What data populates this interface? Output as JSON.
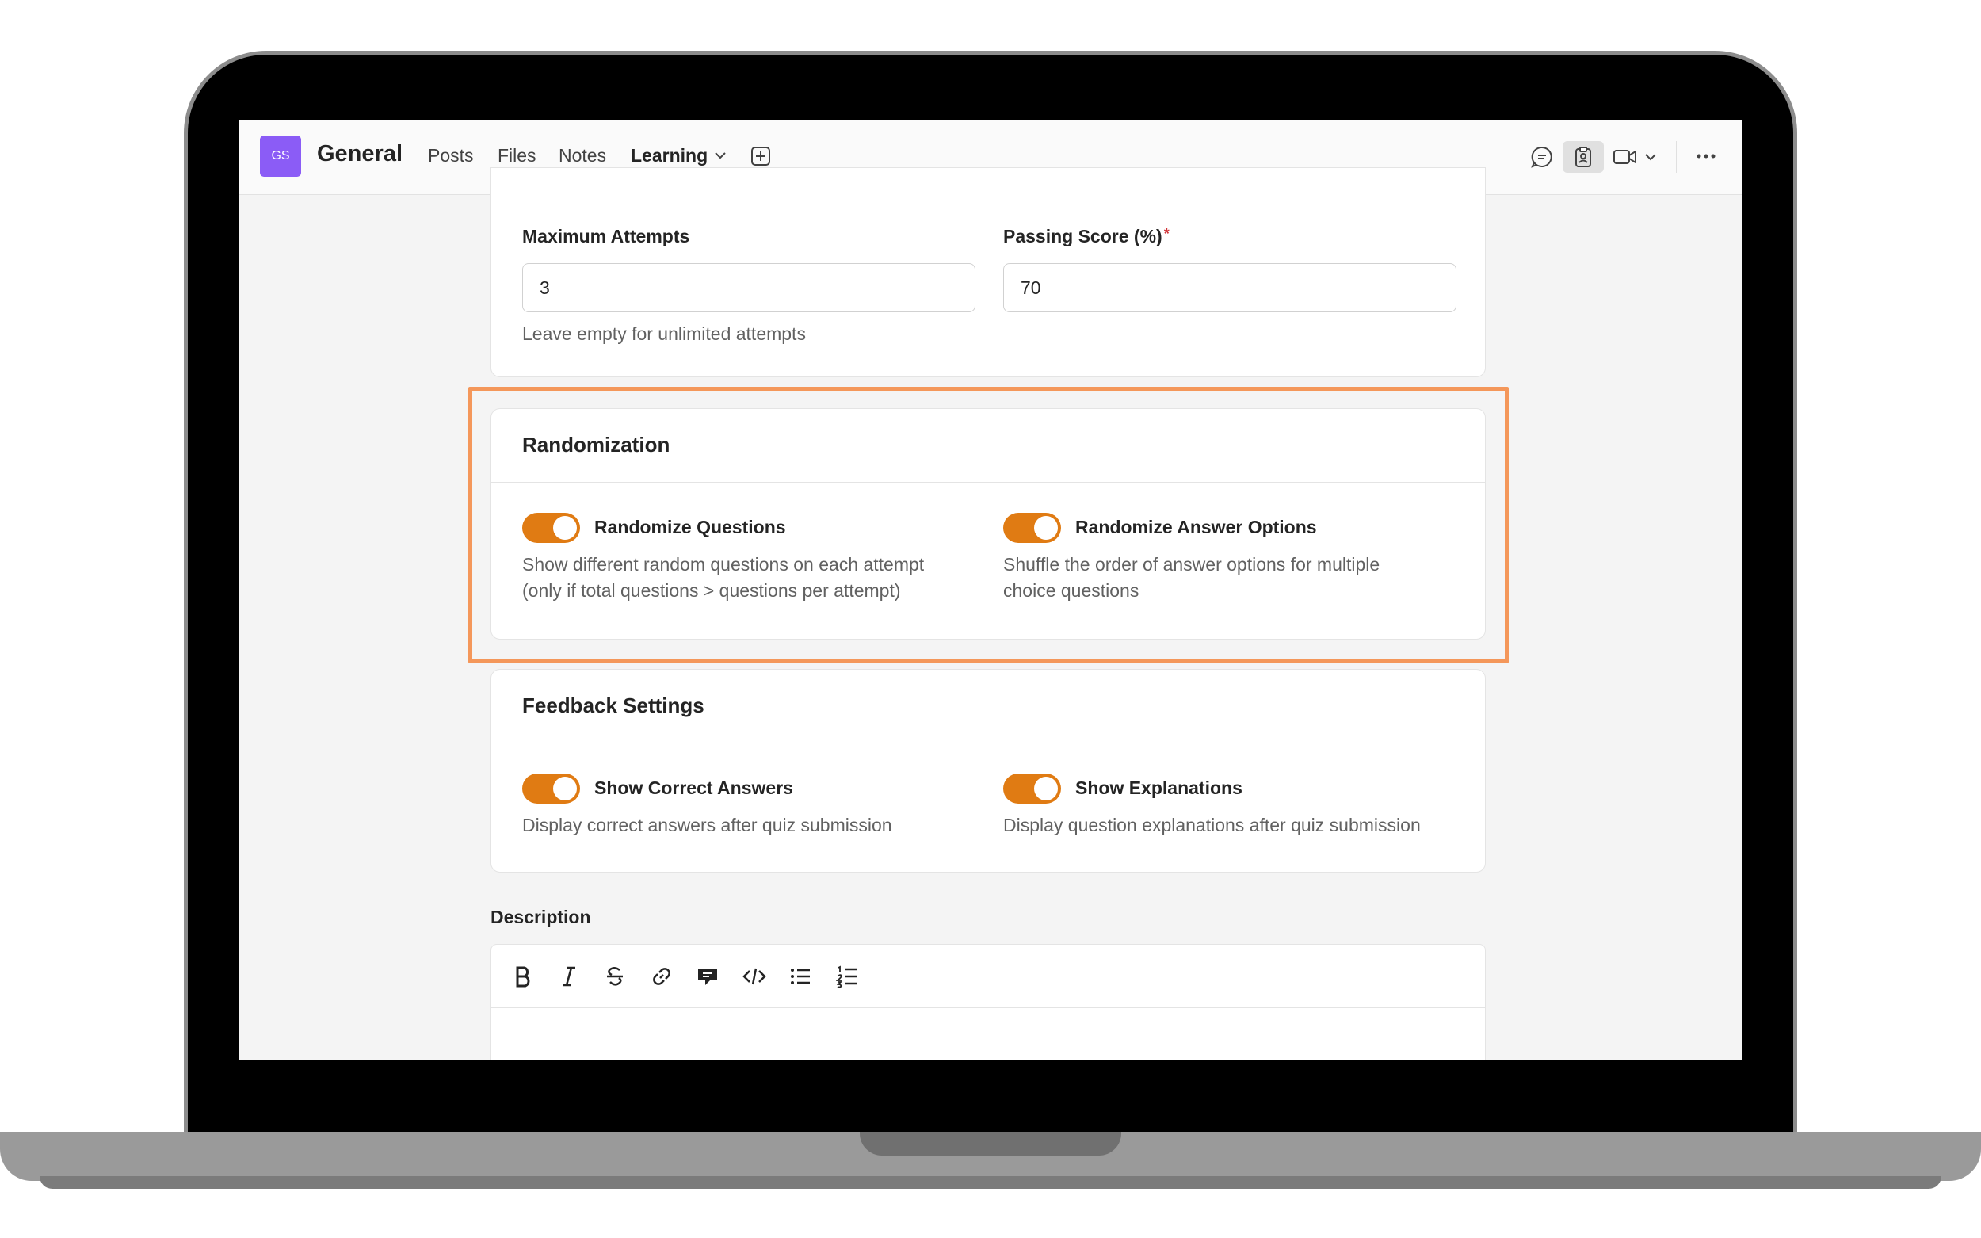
{
  "header": {
    "avatar_initials": "GS",
    "team_name": "General",
    "tabs": [
      {
        "label": "Posts"
      },
      {
        "label": "Files"
      },
      {
        "label": "Notes"
      },
      {
        "label": "Learning",
        "active": true
      }
    ],
    "icons": [
      "chevron-down-icon",
      "add-tab-icon",
      "chat-icon",
      "clipboard-icon",
      "video-icon",
      "more-icon"
    ]
  },
  "attempts": {
    "max_attempts_label": "Maximum Attempts",
    "max_attempts_value": "3",
    "max_attempts_hint": "Leave empty for unlimited attempts",
    "passing_score_label": "Passing Score (%)",
    "passing_score_required": "*",
    "passing_score_value": "70"
  },
  "randomization": {
    "title": "Randomization",
    "questions_label": "Randomize Questions",
    "questions_on": true,
    "questions_desc_line1": "Show different random questions on each attempt",
    "questions_desc_line2": "(only if total questions > questions per attempt)",
    "options_label": "Randomize Answer Options",
    "options_on": true,
    "options_desc_line1": "Shuffle the order of answer options for multiple",
    "options_desc_line2": "choice questions"
  },
  "feedback": {
    "title": "Feedback Settings",
    "correct_label": "Show Correct Answers",
    "correct_on": true,
    "correct_desc": "Display correct answers after quiz submission",
    "explanations_label": "Show Explanations",
    "explanations_on": true,
    "explanations_desc": "Display question explanations after quiz submission"
  },
  "description": {
    "label": "Description",
    "toolbar": [
      "bold-icon",
      "italic-icon",
      "strikethrough-icon",
      "link-icon",
      "comment-icon",
      "code-icon",
      "bullet-list-icon",
      "numbered-list-icon"
    ]
  },
  "colors": {
    "accent": "#5b5fc7",
    "toggle_on": "#e07b13",
    "highlight_border": "#f4975a",
    "avatar": "#8b5cf6"
  }
}
